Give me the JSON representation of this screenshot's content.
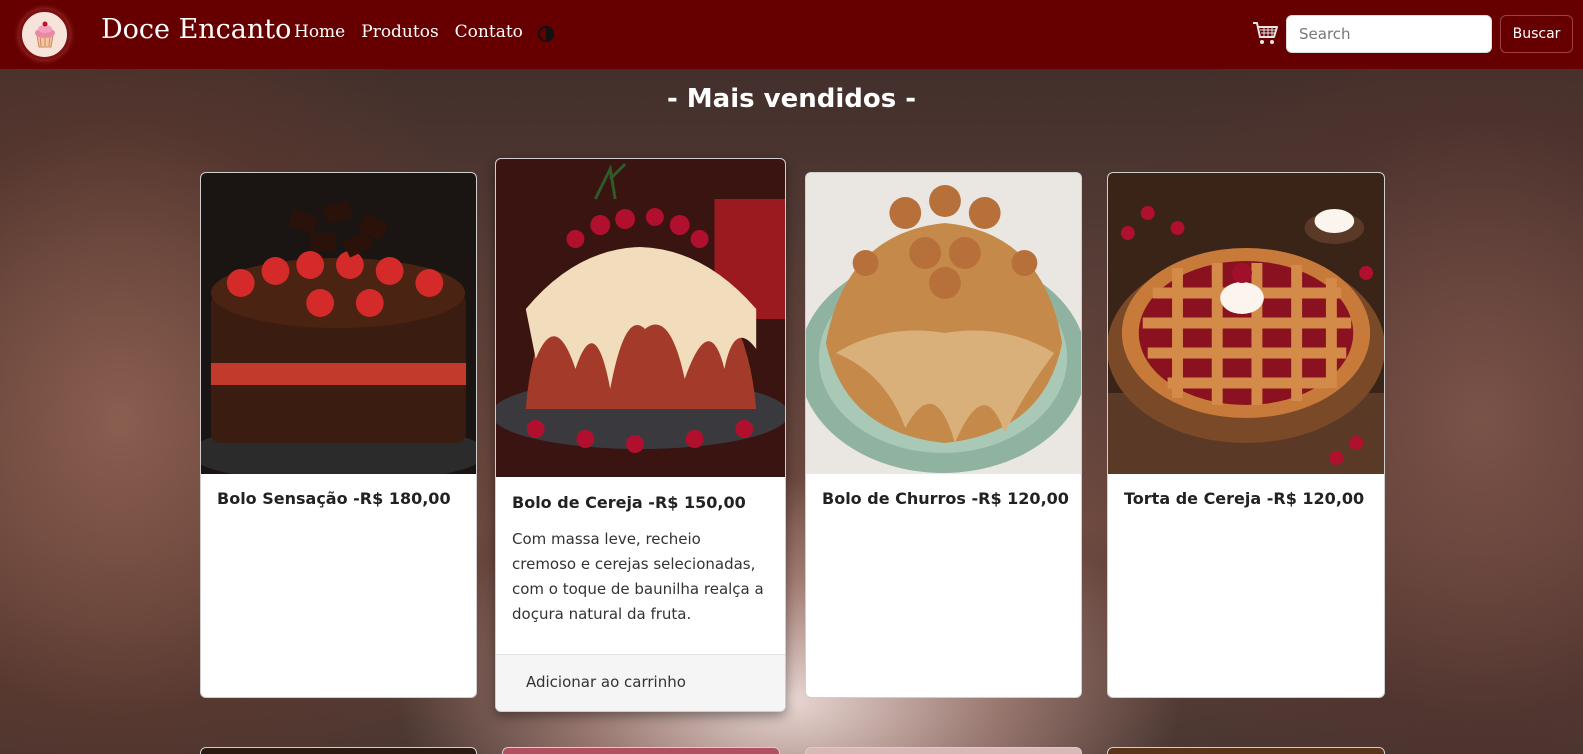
{
  "navbar": {
    "brand": "Doce Encanto",
    "links": [
      "Home",
      "Produtos",
      "Contato"
    ],
    "search_placeholder": "Search",
    "search_button": "Buscar",
    "bg_color": "#660000"
  },
  "section": {
    "title": "- Mais vendidos -"
  },
  "products": [
    {
      "title": "Bolo Sensação -R$ 180,00"
    },
    {
      "title": "Bolo de Cereja -R$ 150,00",
      "description": "Com massa leve, recheio cremoso e cerejas selecionadas, com o toque de baunilha realça a doçura natural da fruta.",
      "cta": "Adicionar ao carrinho"
    },
    {
      "title": "Bolo de Churros -R$ 120,00"
    },
    {
      "title": "Torta de Cereja -R$ 120,00"
    }
  ],
  "icons": {
    "logo": "cupcake-icon",
    "theme": "half-moon-icon",
    "cart": "shopping-cart-icon"
  }
}
